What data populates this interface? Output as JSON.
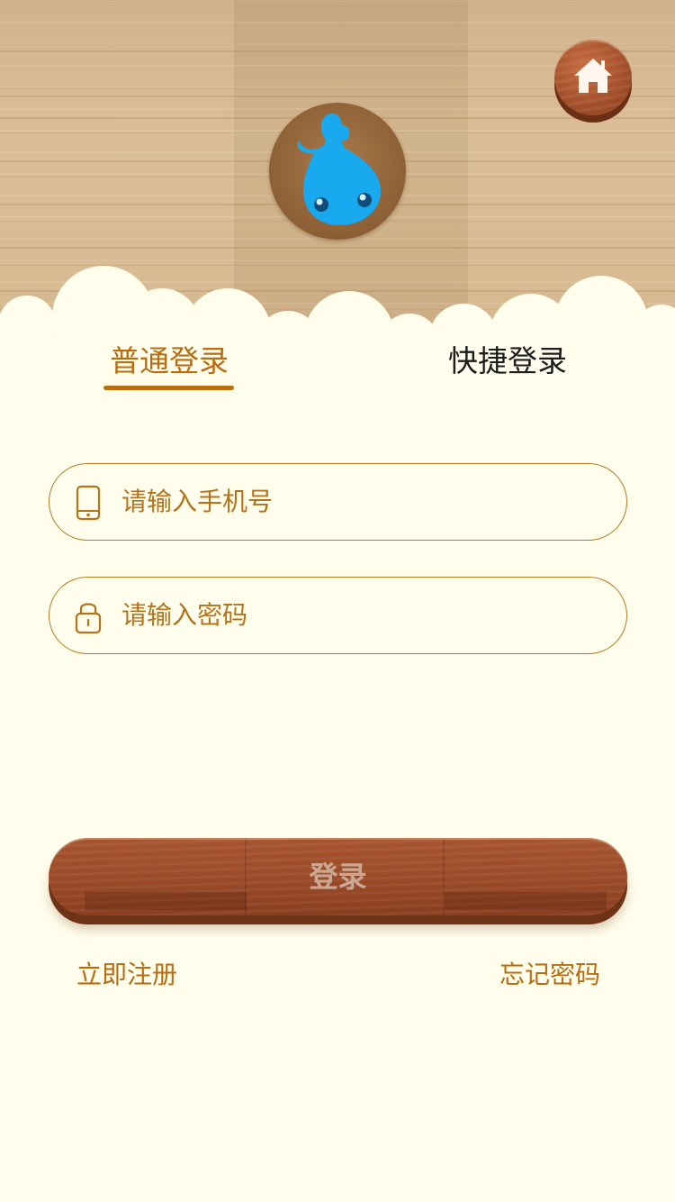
{
  "header": {
    "home_icon": "home-icon",
    "logo_icon": "blue-water-drop-mascot"
  },
  "tabs": [
    {
      "label": "普通登录",
      "active": true
    },
    {
      "label": "快捷登录",
      "active": false
    }
  ],
  "form": {
    "phone": {
      "placeholder": "请输入手机号",
      "value": "",
      "icon": "mobile-phone-icon"
    },
    "password": {
      "placeholder": "请输入密码",
      "value": "",
      "icon": "lock-icon"
    }
  },
  "login_button": {
    "label": "登录"
  },
  "links": {
    "register": "立即注册",
    "forgot": "忘记密码"
  },
  "colors": {
    "accent": "#b86d10",
    "background": "#fffdec",
    "wood": "#9a4a27",
    "mascot": "#18a9ee"
  }
}
